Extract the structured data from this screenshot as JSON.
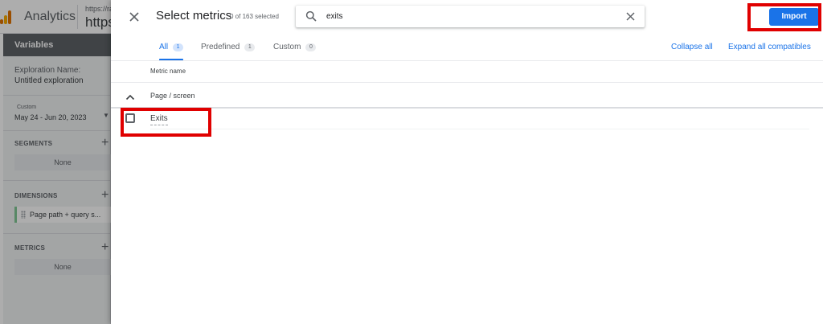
{
  "background_app": {
    "app_name": "Analytics",
    "url_small": "https://ra",
    "url_big": "https",
    "variables_panel": {
      "title": "Variables",
      "exploration_name_label": "Exploration Name:",
      "exploration_name": "Untitled exploration",
      "date_custom_label": "Custom",
      "date_range": "May 24 - Jun 20, 2023",
      "segments_label": "SEGMENTS",
      "segments_value": "None",
      "dimensions_label": "DIMENSIONS",
      "dimension_chip": "Page path + query s...",
      "metrics_label": "METRICS",
      "metrics_value": "None"
    }
  },
  "dialog": {
    "title": "Select metrics",
    "selected_count": "0 of 163 selected",
    "search": {
      "value": "exits",
      "placeholder": ""
    },
    "import_label": "Import",
    "tabs": [
      {
        "label": "All",
        "count": "1",
        "active": true
      },
      {
        "label": "Predefined",
        "count": "1",
        "active": false
      },
      {
        "label": "Custom",
        "count": "0",
        "active": false
      }
    ],
    "collapse_all": "Collapse all",
    "expand_all": "Expand all compatibles",
    "column_header": "Metric name",
    "group": {
      "label": "Page / screen",
      "expanded": true,
      "items": [
        {
          "label": "Exits",
          "checked": false
        }
      ]
    }
  },
  "colors": {
    "accent": "#1a73e8",
    "annotation": "#e00000",
    "scrim": "rgba(0,0,0,0.32)"
  },
  "icons": [
    "close-icon",
    "search-icon",
    "clear-icon",
    "chevron-up-icon",
    "checkbox-icon",
    "analytics-logo-icon",
    "plus-icon",
    "drag-handle-icon"
  ]
}
